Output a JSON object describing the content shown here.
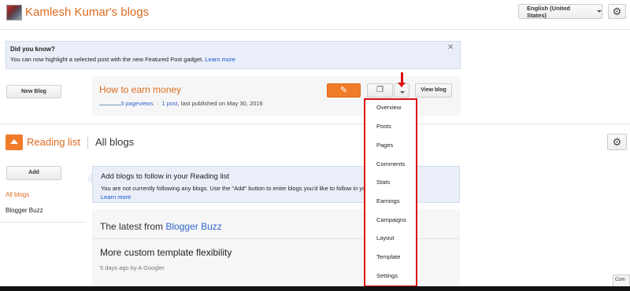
{
  "header": {
    "site_title": "Kamlesh Kumar's blogs",
    "language": "English (United States)"
  },
  "notice": {
    "title": "Did you know?",
    "text": "You can now highlight a selected post with the new Featured Post gadget.",
    "link": "Learn more"
  },
  "blog": {
    "new_blog_label": "New Blog",
    "title": "How to earn money",
    "pageviews": "3 pageviews",
    "posts_link": "1 post",
    "published": ", last published on May 30, 2016",
    "view_blog_label": "View blog"
  },
  "menu": {
    "items": [
      "Overview",
      "Posts",
      "Pages",
      "Comments",
      "Stats",
      "Earnings",
      "Campaigns",
      "Layout",
      "Template",
      "Settings"
    ]
  },
  "reading": {
    "title": "Reading list",
    "all_blogs": "All blogs",
    "add_label": "Add",
    "side_items": [
      "All blogs",
      "Blogger Buzz"
    ],
    "info_title": "Add blogs to follow in your Reading list",
    "info_text": "You are not currently following any blogs. Use the \"Add\" button to enter blogs you'd like to follow in your Reading List.",
    "info_link": "Learn more",
    "latest_prefix": "The latest from",
    "latest_source": "Blogger Buzz",
    "post_title": "More custom template flexibility",
    "post_meta": "5 days ago by A Googler"
  },
  "corner_text": "Com",
  "colors": {
    "brand_orange": "#dd6b1f",
    "button_orange": "#f07c2a",
    "link_blue": "#1155cc",
    "annotation_red": "#dd1111"
  }
}
